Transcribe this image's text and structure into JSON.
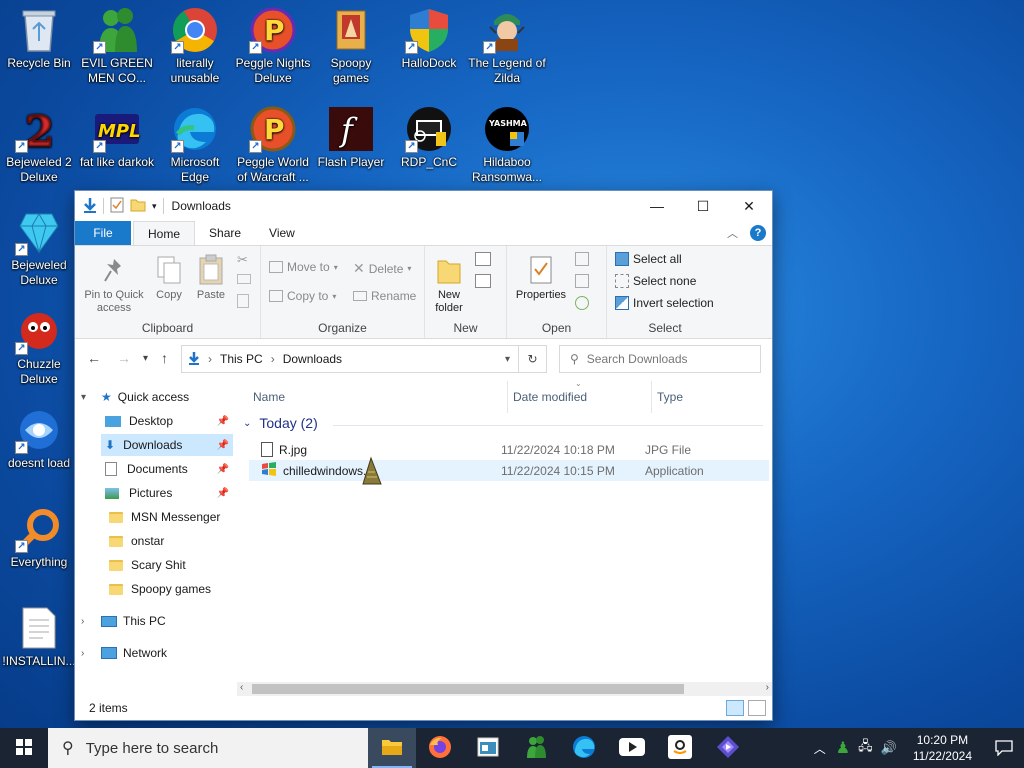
{
  "desktop": {
    "icons": [
      {
        "label": "Recycle Bin"
      },
      {
        "label": "EVIL GREEN MEN CO..."
      },
      {
        "label": "literally unusable"
      },
      {
        "label": "Peggle Nights Deluxe"
      },
      {
        "label": "Spoopy games"
      },
      {
        "label": "HalloDock"
      },
      {
        "label": "The Legend of Zilda"
      },
      {
        "label": "Bejeweled 2 Deluxe"
      },
      {
        "label": "fat like darkok"
      },
      {
        "label": "Microsoft Edge"
      },
      {
        "label": "Peggle World of Warcraft ..."
      },
      {
        "label": "Flash Player"
      },
      {
        "label": "RDP_CnC"
      },
      {
        "label": "Hildaboo Ransomwa..."
      },
      {
        "label": "Bejeweled Deluxe"
      },
      {
        "label": "Chuzzle Deluxe"
      },
      {
        "label": "doesnt load"
      },
      {
        "label": "Everything"
      },
      {
        "label": "!INSTALLIN..."
      }
    ],
    "icon_badges": {
      "mpl": "MPL",
      "yashma": "YASHMA",
      "peggle": "P",
      "bej2": "2",
      "flash": "f"
    }
  },
  "explorer": {
    "title": "Downloads",
    "window_controls": {
      "minimize": "—",
      "maximize": "☐",
      "close": "✕"
    },
    "tabs": [
      {
        "label": "File"
      },
      {
        "label": "Home"
      },
      {
        "label": "Share"
      },
      {
        "label": "View"
      }
    ],
    "help_label": "?",
    "ribbon": {
      "pin_label": "Pin to Quick access",
      "copy_label": "Copy",
      "paste_label": "Paste",
      "clipboard_group": "Clipboard",
      "move_to": "Move to",
      "copy_to": "Copy to",
      "delete": "Delete",
      "rename": "Rename",
      "organize_group": "Organize",
      "new_folder": "New folder",
      "new_group": "New",
      "properties": "Properties",
      "open_group": "Open",
      "select_all": "Select all",
      "select_none": "Select none",
      "invert_selection": "Invert selection",
      "select_group": "Select"
    },
    "address": {
      "crumbs": [
        "This PC",
        "Downloads"
      ],
      "separator": "›",
      "search_placeholder": "Search Downloads"
    },
    "nav": {
      "quick_access": "Quick access",
      "items": [
        {
          "label": "Desktop"
        },
        {
          "label": "Downloads"
        },
        {
          "label": "Documents"
        },
        {
          "label": "Pictures"
        },
        {
          "label": "MSN Messenger"
        },
        {
          "label": "onstar"
        },
        {
          "label": "Scary Shit"
        },
        {
          "label": "Spoopy games"
        }
      ],
      "this_pc": "This PC",
      "network": "Network"
    },
    "columns": {
      "name": "Name",
      "date": "Date modified",
      "type": "Type"
    },
    "group_label": "Today (2)",
    "files": [
      {
        "name": "R.jpg",
        "date": "11/22/2024 10:18 PM",
        "type": "JPG File"
      },
      {
        "name": "chilledwindows.e",
        "date": "11/22/2024 10:15 PM",
        "type": "Application"
      }
    ],
    "status": "2 items"
  },
  "taskbar": {
    "search_placeholder": "Type here to search",
    "clock_time": "10:20 PM",
    "clock_date": "11/22/2024"
  },
  "colors": {
    "accent": "#1979ca",
    "selection": "#cce8ff",
    "taskbar": "#1a2433"
  }
}
